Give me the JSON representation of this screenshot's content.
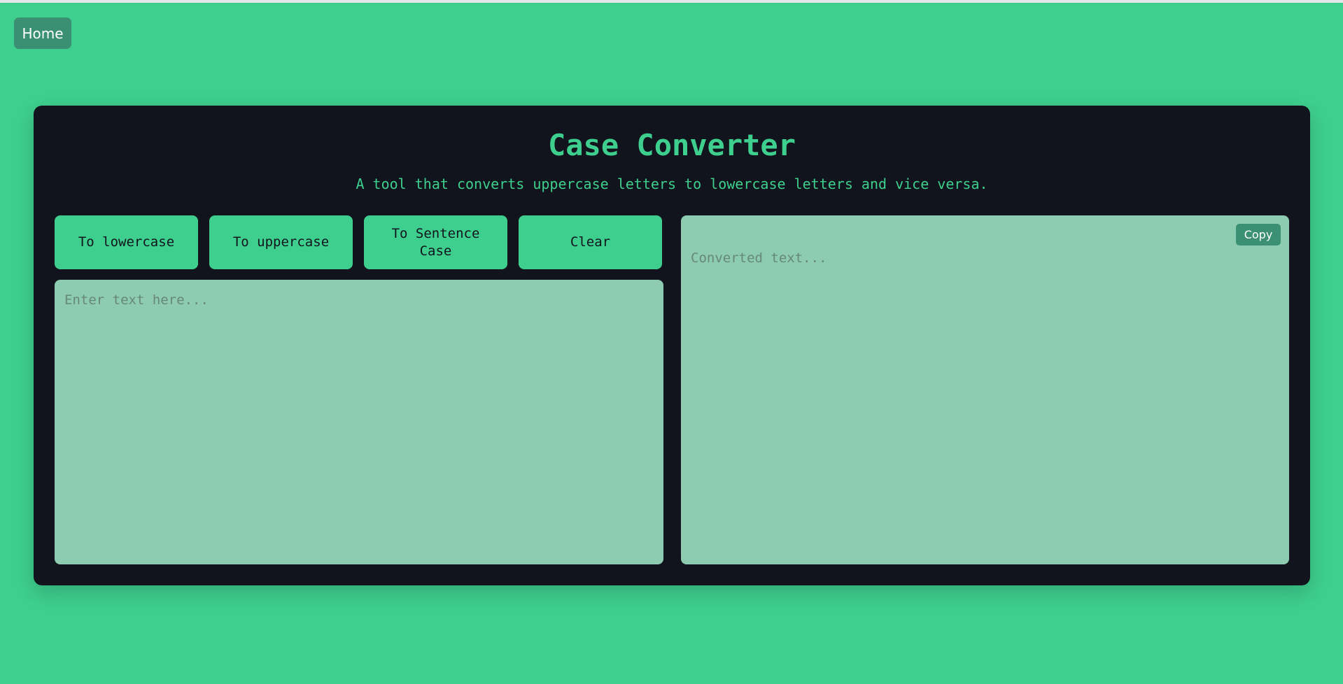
{
  "nav": {
    "home_label": "Home"
  },
  "header": {
    "title": "Case Converter",
    "subtitle": "A tool that converts uppercase letters to lowercase letters and vice versa."
  },
  "actions": {
    "lowercase_label": "To lowercase",
    "uppercase_label": "To uppercase",
    "sentence_label": "To Sentence Case",
    "clear_label": "Clear"
  },
  "input": {
    "value": "",
    "placeholder": "Enter text here..."
  },
  "output": {
    "value": "",
    "placeholder": "Converted text...",
    "copy_label": "Copy"
  },
  "colors": {
    "page_background": "#3ecf8e",
    "panel_background": "#11141c",
    "accent": "#3ecf8e",
    "textarea_background": "#8dccb0",
    "secondary_button": "#3b8f73"
  }
}
